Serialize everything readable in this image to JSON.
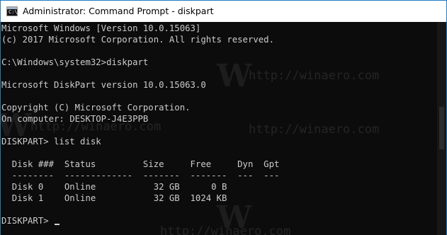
{
  "window": {
    "title": "Administrator: Command Prompt - diskpart",
    "icon": "command-prompt-icon"
  },
  "watermark": {
    "logo": "W",
    "text": "http://winaero.com"
  },
  "console": {
    "lines": [
      "Microsoft Windows [Version 10.0.15063]",
      "(c) 2017 Microsoft Corporation. All rights reserved.",
      "",
      "C:\\Windows\\system32>diskpart",
      "",
      "Microsoft DiskPart version 10.0.15063.0",
      "",
      "Copyright (C) Microsoft Corporation.",
      "On computer: DESKTOP-J4E3PPB",
      "",
      "DISKPART> list disk",
      "",
      "  Disk ###  Status         Size     Free     Dyn  Gpt",
      "  --------  -------------  -------  -------  ---  ---",
      "  Disk 0    Online           32 GB      0 B",
      "  Disk 1    Online           32 GB  1024 KB",
      "",
      "DISKPART> "
    ]
  }
}
